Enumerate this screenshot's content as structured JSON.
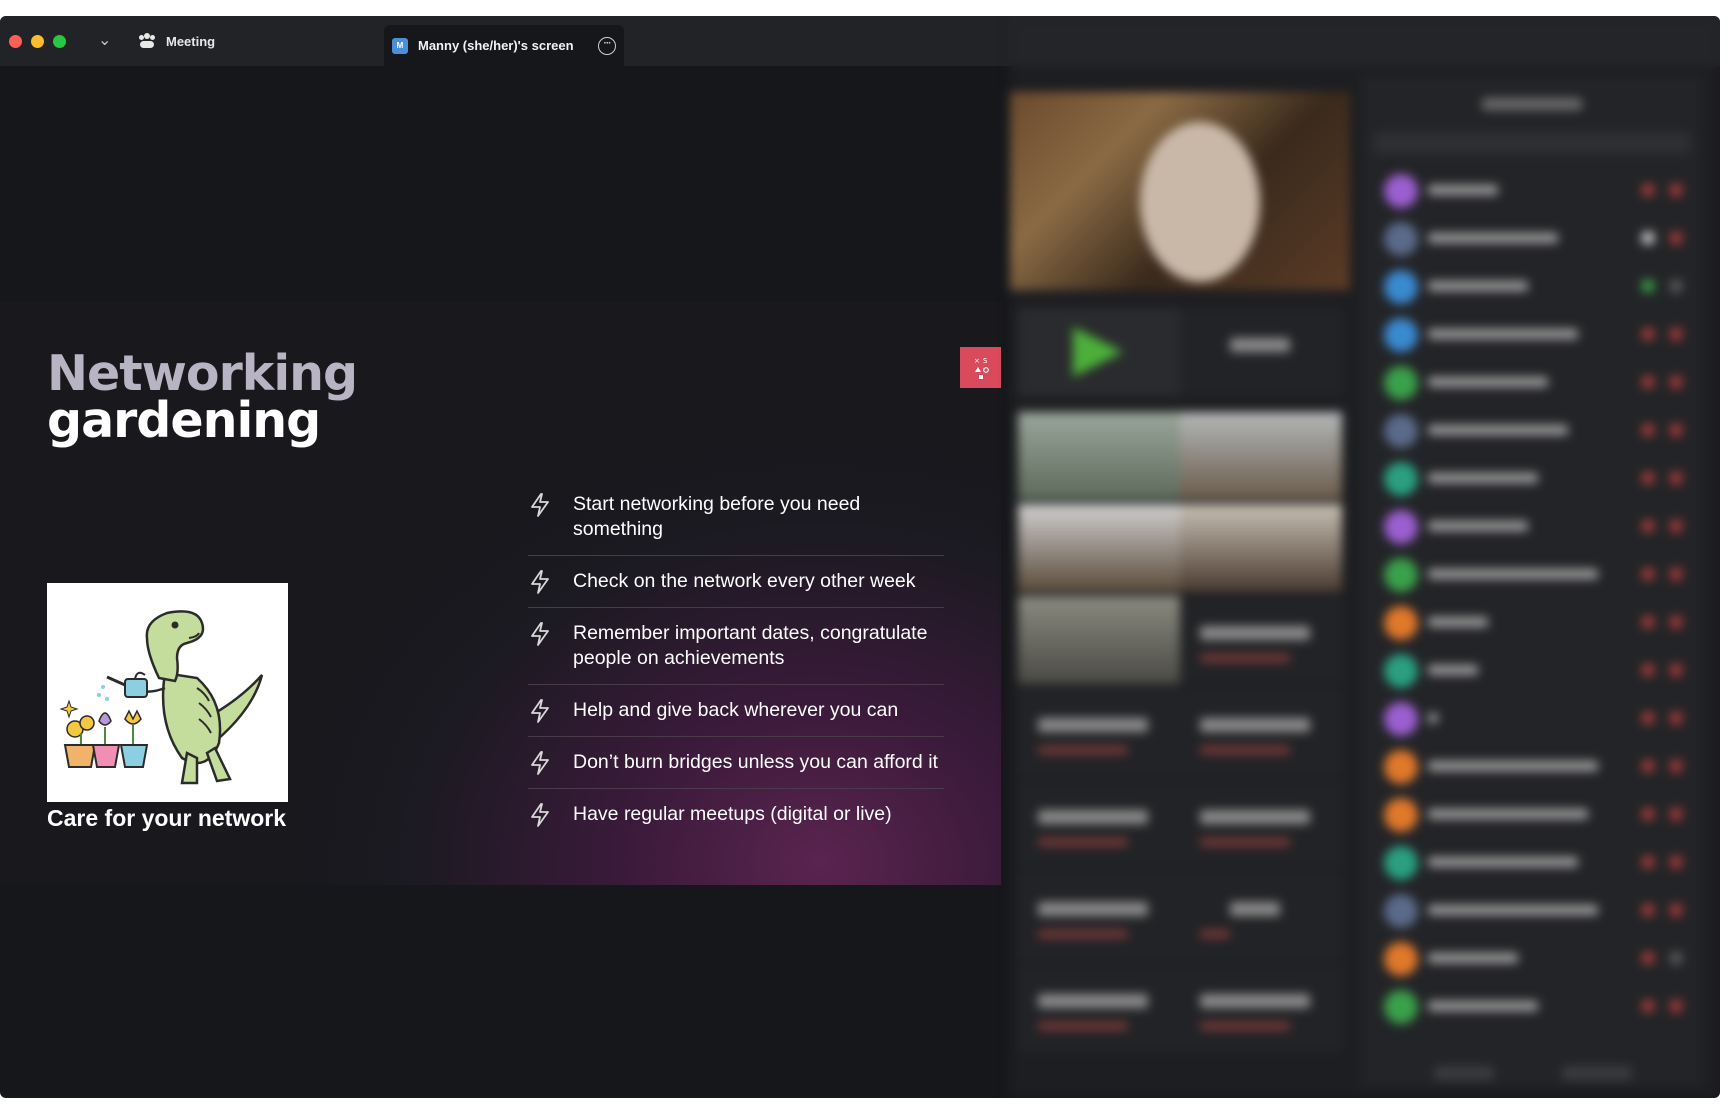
{
  "titlebar": {
    "meeting_tab_label": "Meeting",
    "screen_tab_label": "Manny (she/her)'s screen",
    "screen_tab_avatar": "M",
    "more_glyph": "···"
  },
  "slide": {
    "title_line1": "Networking",
    "title_line2": "gardening",
    "logo_text": "× S\n▲ O\n■",
    "caption": "Care for your network",
    "bullets": [
      "Start networking before you need something",
      "Check on the network every other week",
      "Remember important dates, congratulate people on achievements",
      "Help and give back wherever you can",
      "Don’t burn bridges unless you can afford it",
      "Have regular meetups (digital or live)"
    ]
  },
  "colors": {
    "accent_red": "#d94a5c",
    "slide_purple": "#5a2450",
    "title_muted": "#b9b4c3"
  },
  "icons": [
    "meeting-icon",
    "bolt-icon",
    "chevron-down-icon",
    "more-options-icon"
  ]
}
